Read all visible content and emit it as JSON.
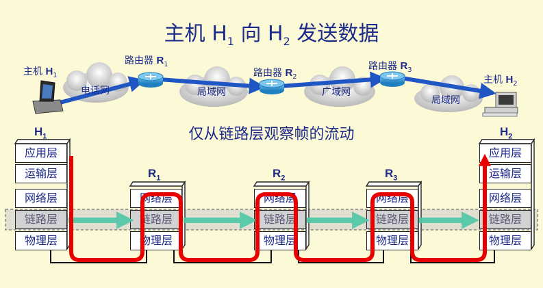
{
  "title": {
    "prefix": "主机 H",
    "sub1": "1",
    "mid": " 向 H",
    "sub2": "2",
    "suffix": " 发送数据"
  },
  "subtitle": "仅从链路层观察帧的流动",
  "hosts": {
    "h1": {
      "label": "主机",
      "name": "H",
      "sub": "1"
    },
    "h2": {
      "label": "主机",
      "name": "H",
      "sub": "2"
    }
  },
  "routers": [
    {
      "label": "路由器",
      "name": "R",
      "sub": "1"
    },
    {
      "label": "路由器",
      "name": "R",
      "sub": "2"
    },
    {
      "label": "路由器",
      "name": "R",
      "sub": "3"
    }
  ],
  "networks": [
    "电话网",
    "局域网",
    "广域网",
    "局域网"
  ],
  "stacks": {
    "h1": {
      "name": "H",
      "sub": "1"
    },
    "r1": {
      "name": "R",
      "sub": "1"
    },
    "r2": {
      "name": "R",
      "sub": "2"
    },
    "r3": {
      "name": "R",
      "sub": "3"
    },
    "h2": {
      "name": "H",
      "sub": "2"
    }
  },
  "layers": {
    "application": "应用层",
    "transport": "运输层",
    "network": "网络层",
    "link": "链路层",
    "physical": "物理层"
  },
  "colors": {
    "background": "#fcf9d6",
    "text": "#1d2b8a",
    "frame_path": "#e60000",
    "link_arrow": "#4fc7a8",
    "data_arrow": "#1f56c4"
  }
}
